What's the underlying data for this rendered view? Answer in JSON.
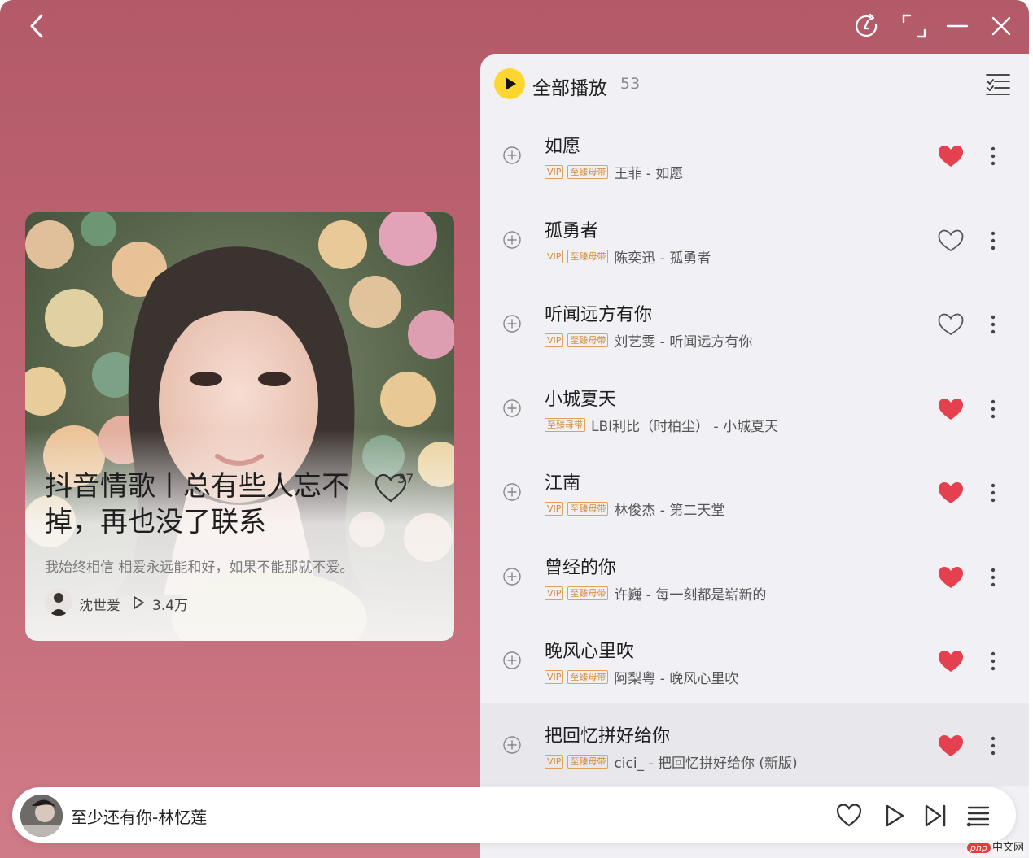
{
  "window": {
    "icons": {
      "back": "chevron-left-icon",
      "rotate": "rotate-icon",
      "fullscreen": "fullscreen-icon",
      "minimize": "minimize-icon",
      "close": "close-icon"
    },
    "background_color": "#b35a68"
  },
  "playlist": {
    "title": "抖音情歌丨总有些人忘不掉，再也没了联系",
    "likes": "37",
    "description": "我始终相信 相爱永远能和好，如果不能那就不爱。",
    "author": "沈世爱",
    "plays": "3.4万"
  },
  "list": {
    "play_all_label": "全部播放",
    "count": "53",
    "accent_color": "#ffd630",
    "songs": [
      {
        "title": "如愿",
        "badges": [
          "VIP",
          "至臻母带"
        ],
        "artist": "王菲 - 如愿",
        "liked": true
      },
      {
        "title": "孤勇者",
        "badges": [
          "VIP",
          "至臻母带"
        ],
        "artist": "陈奕迅 - 孤勇者",
        "liked": false
      },
      {
        "title": "听闻远方有你",
        "badges": [
          "VIP",
          "至臻母带"
        ],
        "artist": "刘艺雯 - 听闻远方有你",
        "liked": false
      },
      {
        "title": "小城夏天",
        "badges": [
          "至臻母带"
        ],
        "artist": "LBI利比（时柏尘） - 小城夏天",
        "liked": true
      },
      {
        "title": "江南",
        "badges": [
          "VIP",
          "至臻母带"
        ],
        "artist": "林俊杰 - 第二天堂",
        "liked": true
      },
      {
        "title": "曾经的你",
        "badges": [
          "VIP",
          "至臻母带"
        ],
        "artist": "许巍 - 每一刻都是崭新的",
        "liked": true
      },
      {
        "title": "晚风心里吹",
        "badges": [
          "VIP",
          "至臻母带"
        ],
        "artist": "阿梨粤 - 晚风心里吹",
        "liked": true
      },
      {
        "title": "把回忆拼好给你",
        "badges": [
          "VIP",
          "至臻母带"
        ],
        "artist": "cici_ - 把回忆拼好给你 (新版)",
        "liked": true
      }
    ],
    "heart_color": "#e5404f"
  },
  "player": {
    "now_playing": "至少还有你-林忆莲",
    "icons": [
      "heart-outline-icon",
      "play-icon",
      "next-icon",
      "queue-icon"
    ]
  },
  "watermark": {
    "brand": "php",
    "text": "中文网"
  }
}
